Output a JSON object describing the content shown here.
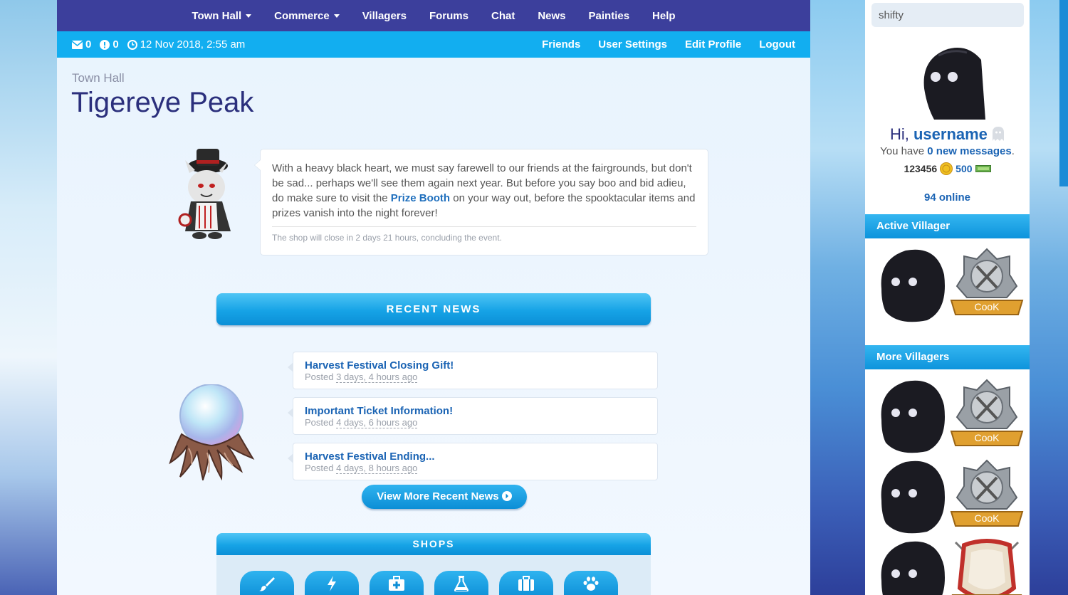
{
  "nav": {
    "items": [
      {
        "label": "Town Hall",
        "dropdown": true
      },
      {
        "label": "Commerce",
        "dropdown": true
      },
      {
        "label": "Villagers",
        "dropdown": false
      },
      {
        "label": "Forums",
        "dropdown": false
      },
      {
        "label": "Chat",
        "dropdown": false
      },
      {
        "label": "News",
        "dropdown": false
      },
      {
        "label": "Painties",
        "dropdown": false
      },
      {
        "label": "Help",
        "dropdown": false
      }
    ]
  },
  "subbar": {
    "mail_count": "0",
    "alert_count": "0",
    "datetime": "12 Nov 2018, 2:55 am",
    "links": [
      "Friends",
      "User Settings",
      "Edit Profile",
      "Logout"
    ]
  },
  "page": {
    "breadcrumb": "Town Hall",
    "title": "Tigereye Peak"
  },
  "notice": {
    "text_before": "With a heavy black heart, we must say farewell to our friends at the fairgrounds, but don't be sad... perhaps we'll see them again next year. But before you say boo and bid adieu, do make sure to visit the ",
    "link": "Prize Booth",
    "text_after": " on your way out, before the spooktacular items and prizes vanish into the night forever!",
    "footer": "The shop will close in 2 days 21 hours, concluding the event."
  },
  "news": {
    "heading": "RECENT NEWS",
    "items": [
      {
        "title": "Harvest Festival Closing Gift!",
        "posted_label": "Posted",
        "ago": "3 days, 4 hours ago"
      },
      {
        "title": "Important Ticket Information!",
        "posted_label": "Posted",
        "ago": "4 days, 6 hours ago"
      },
      {
        "title": "Harvest Festival Ending...",
        "posted_label": "Posted",
        "ago": "4 days, 8 hours ago"
      }
    ],
    "more_button": "View More Recent News"
  },
  "shops": {
    "heading": "SHOPS",
    "icons": [
      "brush-icon",
      "bolt-icon",
      "medkit-icon",
      "flask-icon",
      "suitcase-icon",
      "paw-icon"
    ]
  },
  "sidebar": {
    "search_value": "shifty",
    "greeting": "Hi,",
    "username": "username",
    "messages_prefix": "You have",
    "messages_link": "0 new messages",
    "messages_suffix": ".",
    "currency1": "123456",
    "currency2": "500",
    "online": "94 online",
    "active_heading": "Active Villager",
    "more_heading": "More Villagers",
    "badge_label": "CooK"
  },
  "colors": {
    "nav_bg": "#3c3f9c",
    "subbar_bg": "#12aef0",
    "link": "#1b64b4",
    "title": "#2b2f7c"
  }
}
